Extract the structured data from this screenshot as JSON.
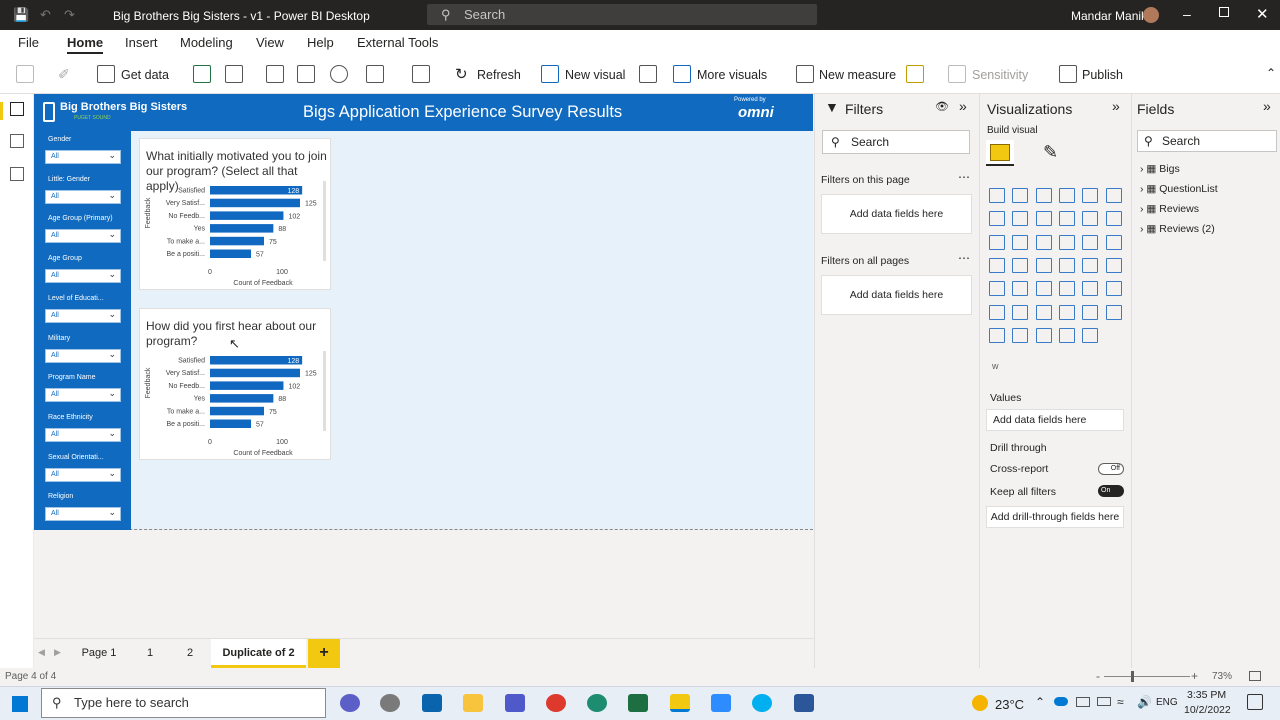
{
  "window": {
    "title": "Big Brothers Big Sisters - v1 - Power BI Desktop",
    "search_placeholder": "Search",
    "user": "Mandar Manik"
  },
  "menu": [
    "File",
    "Home",
    "Insert",
    "Modeling",
    "View",
    "Help",
    "External Tools"
  ],
  "ribbon": {
    "get_data": "Get data",
    "refresh": "Refresh",
    "new_visual": "New visual",
    "more_visuals": "More visuals",
    "new_measure": "New measure",
    "sensitivity": "Sensitivity",
    "publish": "Publish"
  },
  "report": {
    "logo": "Big Brothers Big Sisters",
    "logo_sub": "PUGET SOUND",
    "title": "Bigs Application Experience Survey Results",
    "powered_by": "Powered by",
    "omni": "omni"
  },
  "slicers": [
    {
      "label": "Gender",
      "value": "All"
    },
    {
      "label": "Little: Gender",
      "value": "All"
    },
    {
      "label": "Age Group (Primary)",
      "value": "All"
    },
    {
      "label": "Age Group",
      "value": "All"
    },
    {
      "label": "Level of Educati...",
      "value": "All"
    },
    {
      "label": "Military",
      "value": "All"
    },
    {
      "label": "Program Name",
      "value": "All"
    },
    {
      "label": "Race Ethnicity",
      "value": "All"
    },
    {
      "label": "Sexual Orientati...",
      "value": "All"
    },
    {
      "label": "Religion",
      "value": "All"
    }
  ],
  "chart_data": [
    {
      "type": "bar",
      "title": "What initially motivated you to join our program? (Select all that apply)",
      "categories": [
        "Satisfied",
        "Very Satisf...",
        "No Feedb...",
        "Yes",
        "To make a...",
        "Be a positi..."
      ],
      "values": [
        128,
        125,
        102,
        88,
        75,
        57
      ],
      "xlabel": "Count of Feedback",
      "ylabel": "Feedback",
      "xticks": [
        "0",
        "100"
      ]
    },
    {
      "type": "bar",
      "title": "How did you first hear about our program?",
      "categories": [
        "Satisfied",
        "Very Satisf...",
        "No Feedb...",
        "Yes",
        "To make a...",
        "Be a positi..."
      ],
      "values": [
        128,
        125,
        102,
        88,
        75,
        57
      ],
      "xlabel": "Count of Feedback",
      "ylabel": "Feedback",
      "xticks": [
        "0",
        "100"
      ]
    }
  ],
  "tabs": [
    "Page 1",
    "1",
    "2",
    "Duplicate of 2"
  ],
  "status": {
    "page": "Page 4 of 4",
    "zoom": "73%"
  },
  "filters": {
    "title": "Filters",
    "search": "Search",
    "on_page": "Filters on this page",
    "on_all": "Filters on all pages",
    "add": "Add data fields here"
  },
  "viz": {
    "title": "Visualizations",
    "build": "Build visual",
    "values": "Values",
    "add_values": "Add data fields here",
    "drill": "Drill through",
    "cross": "Cross-report",
    "cross_state": "Off",
    "keep": "Keep all filters",
    "keep_state": "On",
    "add_drill": "Add drill-through fields here",
    "w": "w"
  },
  "fields": {
    "title": "Fields",
    "search": "Search",
    "items": [
      "Bigs",
      "QuestionList",
      "Reviews",
      "Reviews (2)"
    ]
  },
  "taskbar": {
    "search": "Type here to search",
    "temp": "23°C",
    "lang": "ENG",
    "time": "3:35 PM",
    "date": "10/2/2022"
  }
}
